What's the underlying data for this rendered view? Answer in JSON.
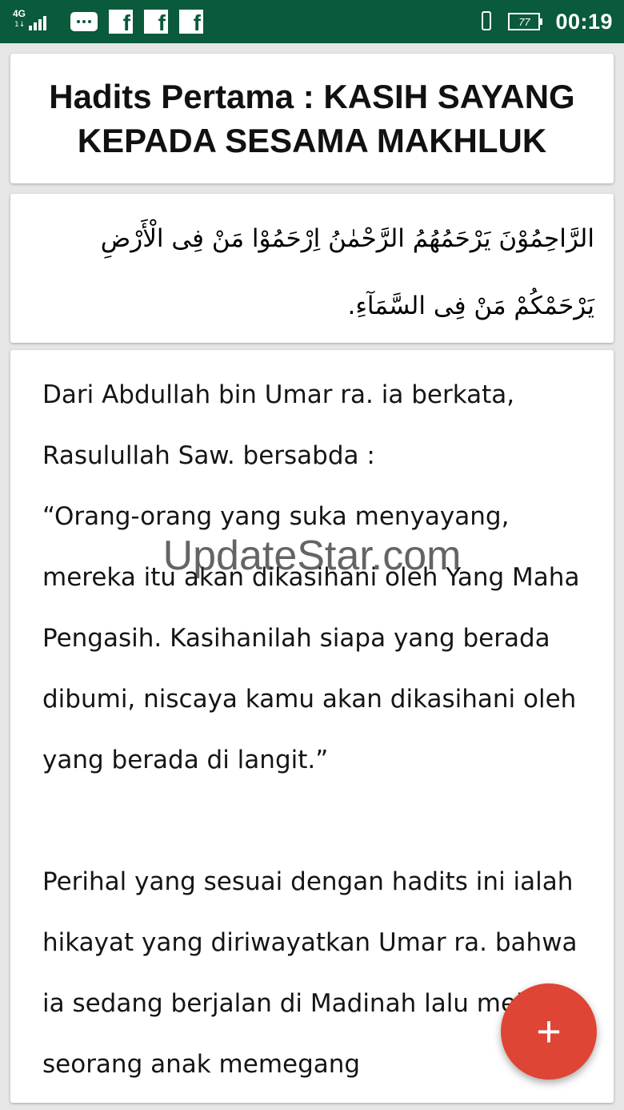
{
  "status_bar": {
    "network": "4G",
    "network_sub": "1↓",
    "battery": "77",
    "time": "00:19",
    "notification_icons": [
      "chat-icon",
      "facebook-icon",
      "facebook-icon",
      "facebook-icon"
    ]
  },
  "hadith": {
    "title": "Hadits Pertama : KASIH SAYANG KEPADA SESAMA MAKHLUK",
    "arabic": "الرَّاحِمُوْنَ يَرْحَمُهُمُ الرَّحْمٰنُ اِرْحَمُوْا مَنْ فِى الْأَرْضِ يَرْحَمْكُمْ مَنْ فِى السَّمَآءِ.",
    "paragraphs": [
      "Dari Abdullah bin Umar ra. ia berkata, Rasulullah Saw. bersabda :",
      "“Orang-orang yang suka menyayang, mereka itu akan dikasihani oleh Yang Maha Pengasih. Kasihanilah siapa yang berada dibumi, niscaya kamu akan dikasihani oleh yang berada di langit.”",
      "Perihal yang sesuai dengan hadits ini ialah hikayat yang diriwayatkan Umar ra. bahwa ia sedang berjalan di Madinah lalu melihat seorang anak memegang"
    ]
  },
  "watermark": "UpdateStar.com",
  "fab": {
    "label": "+"
  },
  "colors": {
    "status_bar": "#0a5a3c",
    "fab": "#de4535",
    "background": "#e6e6e6"
  }
}
